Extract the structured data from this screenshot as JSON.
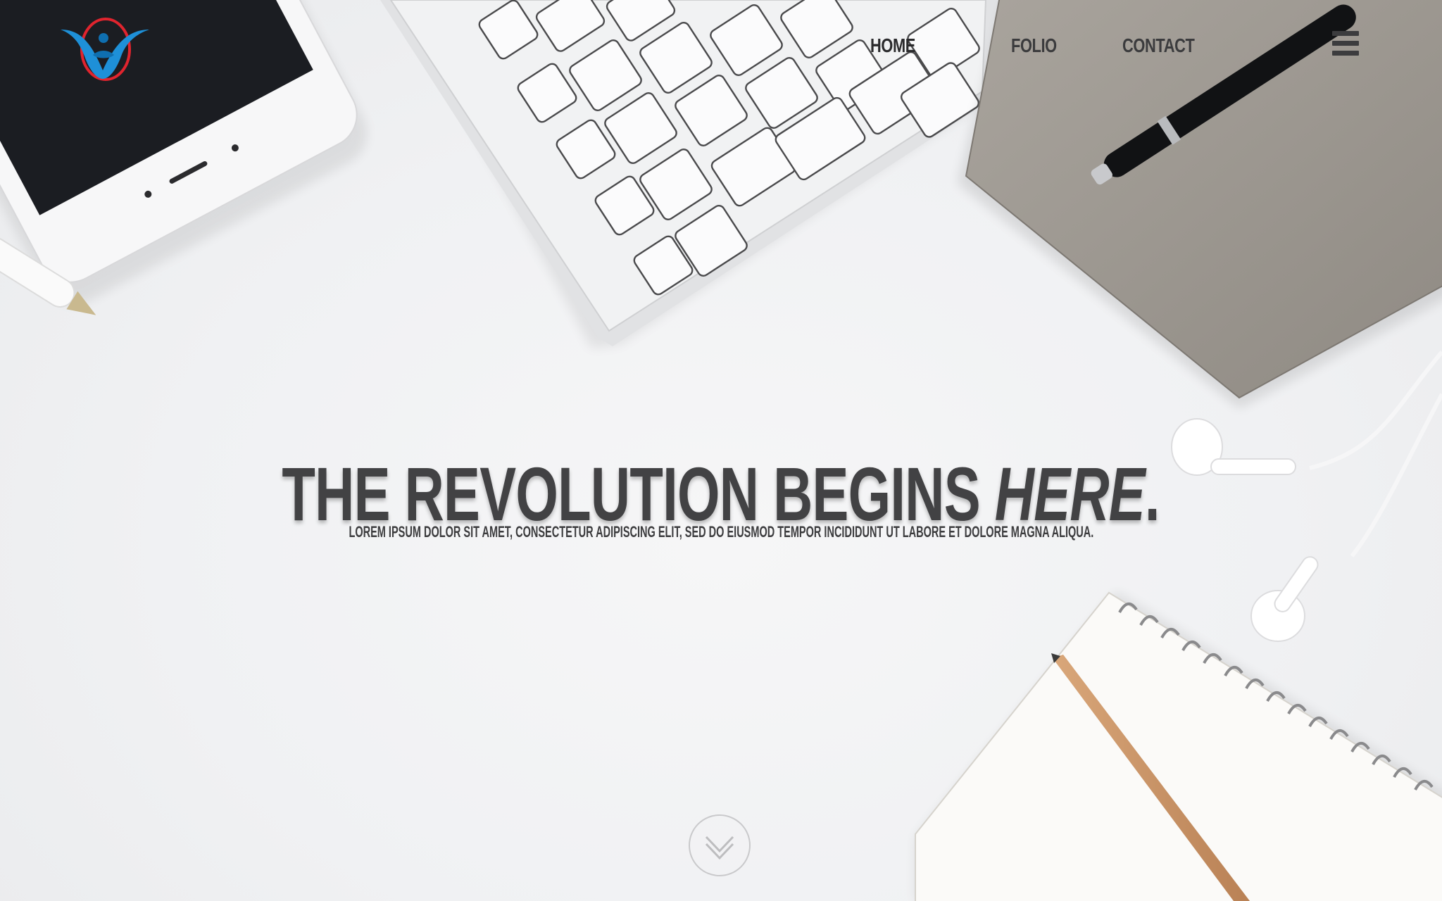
{
  "brand": {
    "logo_icon": "person-drop-logo-icon",
    "colors": {
      "logo_blue": "#1e90d8",
      "logo_ring": "#e0242e"
    }
  },
  "nav": {
    "items": [
      {
        "label": "HOME",
        "active": true
      },
      {
        "label": "FOLIO",
        "active": false
      },
      {
        "label": "CONTACT",
        "active": false
      }
    ],
    "menu_icon": "hamburger-menu-icon"
  },
  "hero": {
    "title_main": "THE REVOLUTION BEGINS ",
    "title_emphasis": "HERE",
    "title_end": ".",
    "subtitle": "LOREM IPSUM DOLOR SIT AMET, CONSECTETUR ADIPISCING ELIT, SED DO EIUSMOD TEMPOR INCIDIDUNT UT LABORE ET DOLORE MAGNA ALIQUA."
  },
  "scroll": {
    "icon": "chevron-down-icon"
  },
  "theme": {
    "text_color": "#424244",
    "background": "#f0f1f3"
  }
}
